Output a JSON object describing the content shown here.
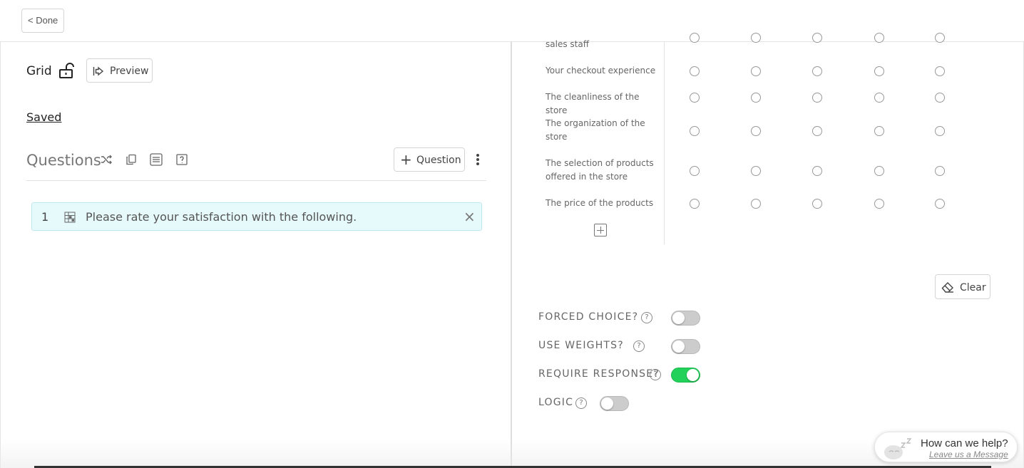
{
  "topbar": {
    "done_label": "< Done"
  },
  "editor": {
    "question_type": "Grid",
    "preview_label": "Preview",
    "saved_label": "Saved",
    "questions_title": "Questions",
    "add_question_label": "Question",
    "add_question_symbol": "+"
  },
  "questions": [
    {
      "number": "1",
      "text": "Please rate your satisfaction with the following.",
      "icon": "grid-icon",
      "remove_symbol": "×"
    }
  ],
  "grid": {
    "rows": [
      {
        "label": "sales staff",
        "selected_column": null
      },
      {
        "label": "Your checkout experience",
        "selected_column": null
      },
      {
        "label": "The cleanliness of the store",
        "selected_column": null
      },
      {
        "label": "The organization of the store",
        "selected_column": null
      },
      {
        "label": "The selection of products offered in the store",
        "selected_column": null
      },
      {
        "label": "The price of the products",
        "selected_column": null
      }
    ],
    "column_count": 5
  },
  "actions": {
    "clear_label": "Clear"
  },
  "settings": [
    {
      "label": "FORCED CHOICE?",
      "help": "?",
      "enabled": false
    },
    {
      "label": "USE WEIGHTS?",
      "help": "?",
      "enabled": false
    },
    {
      "label": "REQUIRE RESPONSE?",
      "help": "?",
      "enabled": true
    },
    {
      "label": "LOGIC",
      "help": "?",
      "enabled": false
    }
  ],
  "help_widget": {
    "title": "How can we help?",
    "link": "Leave us a Message"
  },
  "colors": {
    "accent_highlight": "#e6f9fb",
    "toggle_on": "#22d15a",
    "toggle_off": "#cccccc"
  }
}
